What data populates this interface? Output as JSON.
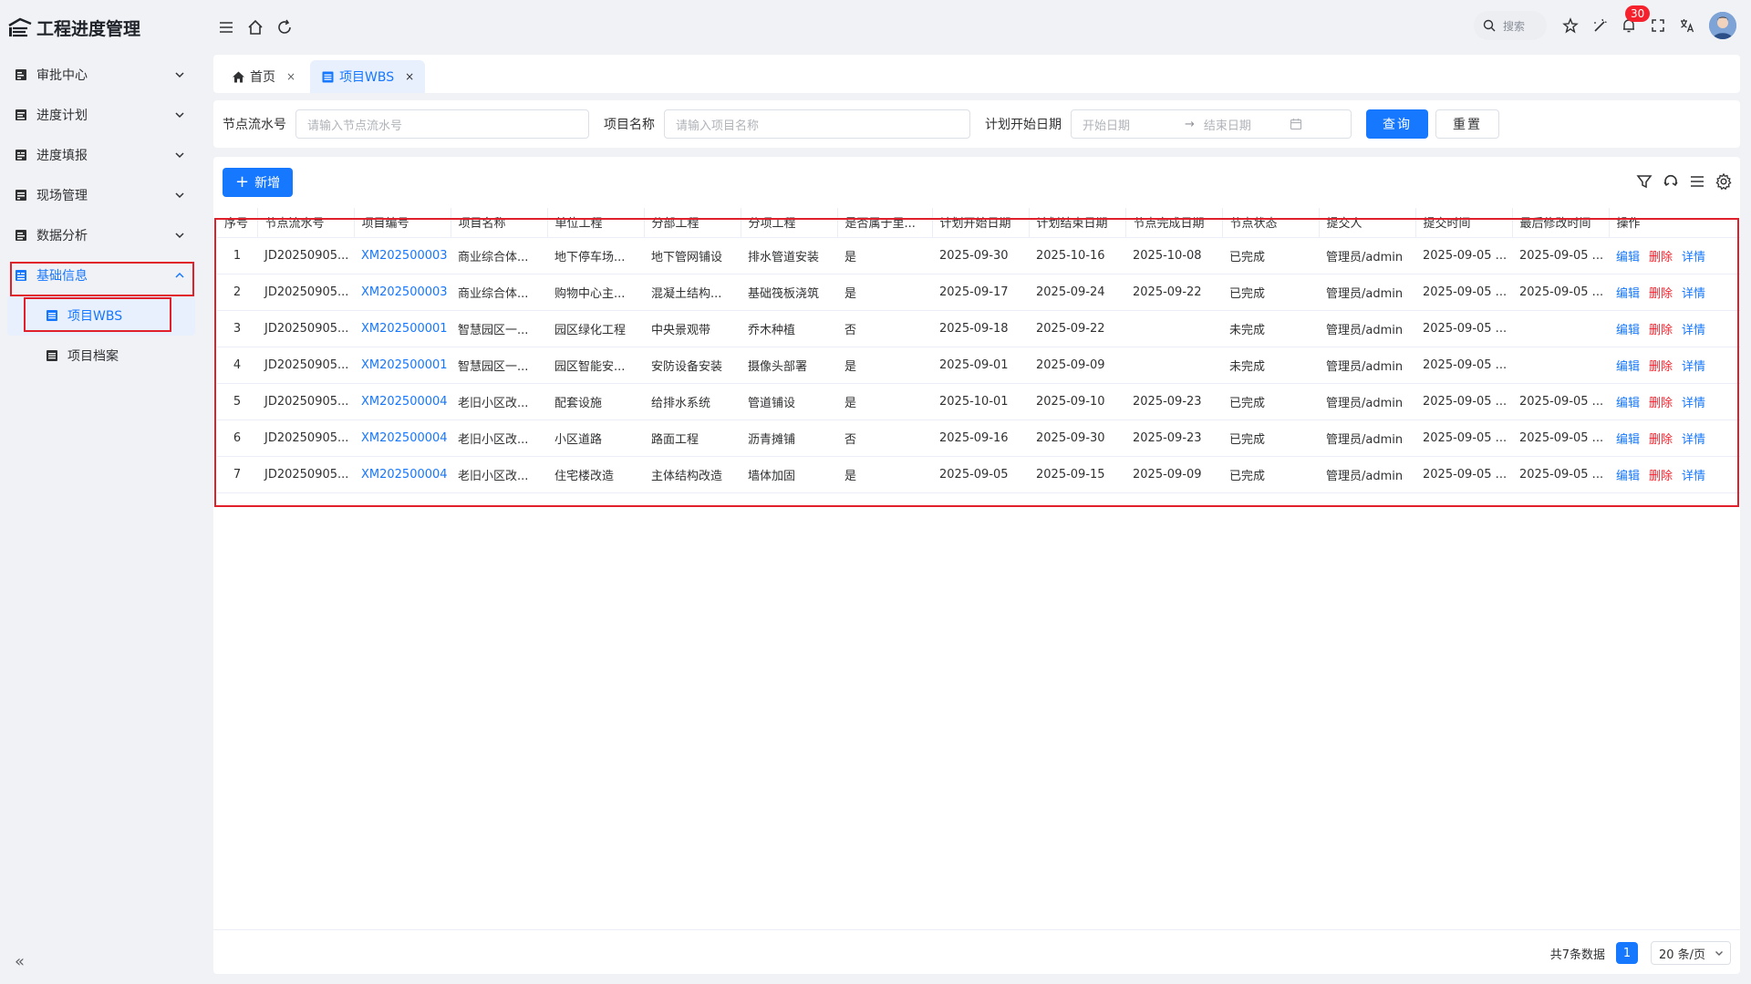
{
  "app": {
    "title": "工程进度管理"
  },
  "sidebar": {
    "items": [
      {
        "label": "审批中心",
        "icon": "approval-icon"
      },
      {
        "label": "进度计划",
        "icon": "plan-icon"
      },
      {
        "label": "进度填报",
        "icon": "report-icon"
      },
      {
        "label": "现场管理",
        "icon": "site-icon"
      },
      {
        "label": "数据分析",
        "icon": "analysis-icon"
      },
      {
        "label": "基础信息",
        "icon": "base-info-icon",
        "active": true
      }
    ],
    "subitems": [
      {
        "label": "项目WBS",
        "active": true
      },
      {
        "label": "项目档案"
      }
    ],
    "collapse_label": "«"
  },
  "topbar": {
    "search_label": "搜索",
    "notification_count": "30"
  },
  "tabs": [
    {
      "label": "首页",
      "close": "×"
    },
    {
      "label": "项目WBS",
      "close": "×",
      "active": true
    }
  ],
  "filters": {
    "node_serial": {
      "label": "节点流水号",
      "placeholder": "请输入节点流水号"
    },
    "project_name": {
      "label": "项目名称",
      "placeholder": "请输入项目名称"
    },
    "plan_start": {
      "label": "计划开始日期",
      "start_placeholder": "开始日期",
      "separator": "→",
      "end_placeholder": "结束日期"
    },
    "query_label": "查询",
    "reset_label": "重置"
  },
  "toolbar": {
    "add_label": "新增",
    "add_plus": "+"
  },
  "table": {
    "headers": [
      "序号",
      "节点流水号",
      "项目编号",
      "项目名称",
      "单位工程",
      "分部工程",
      "分项工程",
      "是否属于里...",
      "计划开始日期",
      "计划结束日期",
      "节点完成日期",
      "节点状态",
      "提交人",
      "提交时间",
      "最后修改时间",
      "操作"
    ],
    "rows": [
      [
        "1",
        "JD20250905...",
        "XM202500003",
        "商业综合体...",
        "地下停车场...",
        "地下管网铺设",
        "排水管道安装",
        "是",
        "2025-09-30",
        "2025-10-16",
        "2025-10-08",
        "已完成",
        "管理员/admin",
        "2025-09-05 ...",
        "2025-09-05 ..."
      ],
      [
        "2",
        "JD20250905...",
        "XM202500003",
        "商业综合体...",
        "购物中心主...",
        "混凝土结构...",
        "基础筏板浇筑",
        "是",
        "2025-09-17",
        "2025-09-24",
        "2025-09-22",
        "已完成",
        "管理员/admin",
        "2025-09-05 ...",
        "2025-09-05 ..."
      ],
      [
        "3",
        "JD20250905...",
        "XM202500001",
        "智慧园区一...",
        "园区绿化工程",
        "中央景观带",
        "乔木种植",
        "否",
        "2025-09-18",
        "2025-09-22",
        "",
        "未完成",
        "管理员/admin",
        "2025-09-05 ...",
        ""
      ],
      [
        "4",
        "JD20250905...",
        "XM202500001",
        "智慧园区一...",
        "园区智能安...",
        "安防设备安装",
        "摄像头部署",
        "是",
        "2025-09-01",
        "2025-09-09",
        "",
        "未完成",
        "管理员/admin",
        "2025-09-05 ...",
        ""
      ],
      [
        "5",
        "JD20250905...",
        "XM202500004",
        "老旧小区改...",
        "配套设施",
        "给排水系统",
        "管道铺设",
        "是",
        "2025-10-01",
        "2025-09-10",
        "2025-09-23",
        "已完成",
        "管理员/admin",
        "2025-09-05 ...",
        "2025-09-05 ..."
      ],
      [
        "6",
        "JD20250905...",
        "XM202500004",
        "老旧小区改...",
        "小区道路",
        "路面工程",
        "沥青摊铺",
        "否",
        "2025-09-16",
        "2025-09-30",
        "2025-09-23",
        "已完成",
        "管理员/admin",
        "2025-09-05 ...",
        "2025-09-05 ..."
      ],
      [
        "7",
        "JD20250905...",
        "XM202500004",
        "老旧小区改...",
        "住宅楼改造",
        "主体结构改造",
        "墙体加固",
        "是",
        "2025-09-05",
        "2025-09-15",
        "2025-09-09",
        "已完成",
        "管理员/admin",
        "2025-09-05 ...",
        "2025-09-05 ..."
      ]
    ],
    "actions": {
      "edit": "编辑",
      "delete": "删除",
      "detail": "详情"
    }
  },
  "pagination": {
    "total": "共7条数据",
    "current": "1",
    "page_size": "20 条/页"
  },
  "colors": {
    "accent": "#1677ff",
    "danger": "#f5222d",
    "highlight_box": "#e0202b"
  }
}
